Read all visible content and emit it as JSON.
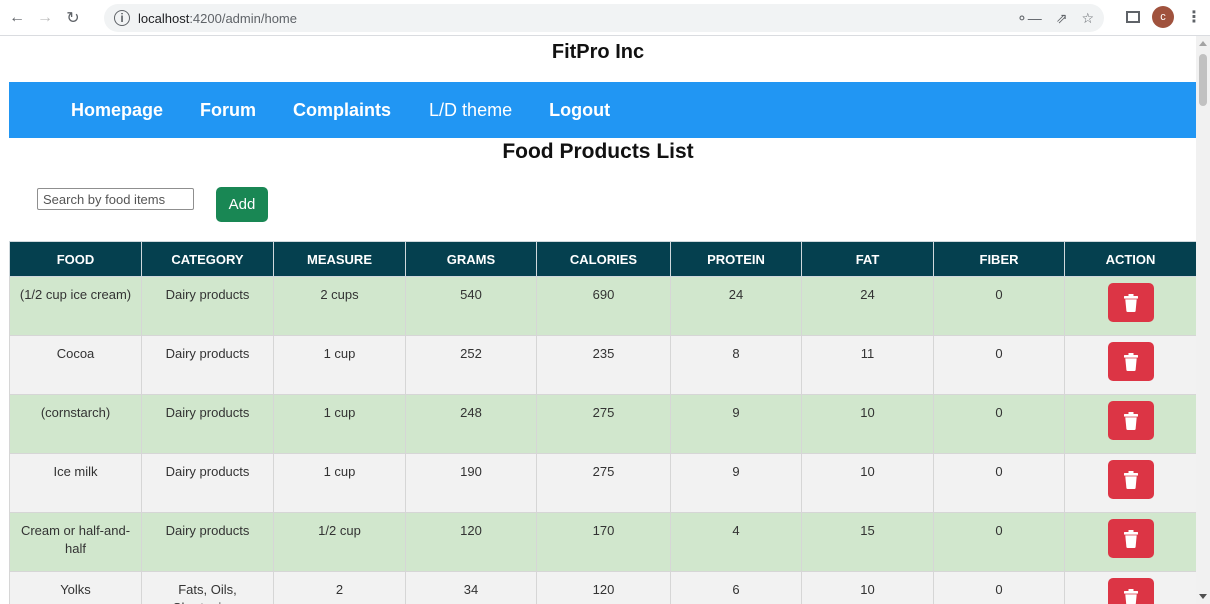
{
  "browser": {
    "url_host": "localhost",
    "url_rest": ":4200/admin/home",
    "avatar_letter": "c"
  },
  "site": {
    "title": "FitPro Inc"
  },
  "nav": {
    "items": [
      {
        "label": "Homepage"
      },
      {
        "label": "Forum"
      },
      {
        "label": "Complaints"
      },
      {
        "label": "L/D theme"
      },
      {
        "label": "Logout"
      }
    ]
  },
  "page": {
    "title": "Food Products List",
    "search_placeholder": "Search by food items",
    "add_label": "Add"
  },
  "colors": {
    "nav_bg": "#2196f3",
    "header_bg": "#05404f",
    "row_green": "#d1e7cd",
    "row_grey": "#f2f2f2",
    "add_btn": "#198754",
    "delete_btn": "#dc3545"
  },
  "table": {
    "headers": [
      "FOOD",
      "CATEGORY",
      "MEASURE",
      "GRAMS",
      "CALORIES",
      "PROTEIN",
      "FAT",
      "FIBER",
      "ACTION"
    ],
    "rows": [
      {
        "food": "(1/2 cup ice cream)",
        "category": "Dairy products",
        "measure": "2 cups",
        "grams": "540",
        "calories": "690",
        "protein": "24",
        "fat": "24",
        "fiber": "0"
      },
      {
        "food": "Cocoa",
        "category": "Dairy products",
        "measure": "1 cup",
        "grams": "252",
        "calories": "235",
        "protein": "8",
        "fat": "11",
        "fiber": "0"
      },
      {
        "food": "(cornstarch)",
        "category": "Dairy products",
        "measure": "1 cup",
        "grams": "248",
        "calories": "275",
        "protein": "9",
        "fat": "10",
        "fiber": "0"
      },
      {
        "food": "Ice milk",
        "category": "Dairy products",
        "measure": "1 cup",
        "grams": "190",
        "calories": "275",
        "protein": "9",
        "fat": "10",
        "fiber": "0"
      },
      {
        "food": "Cream or half-and-half",
        "category": "Dairy products",
        "measure": "1/2 cup",
        "grams": "120",
        "calories": "170",
        "protein": "4",
        "fat": "15",
        "fiber": "0"
      },
      {
        "food": "Yolks",
        "category": "Fats, Oils, Shortenings",
        "measure": "2",
        "grams": "34",
        "calories": "120",
        "protein": "6",
        "fat": "10",
        "fiber": "0"
      }
    ]
  }
}
